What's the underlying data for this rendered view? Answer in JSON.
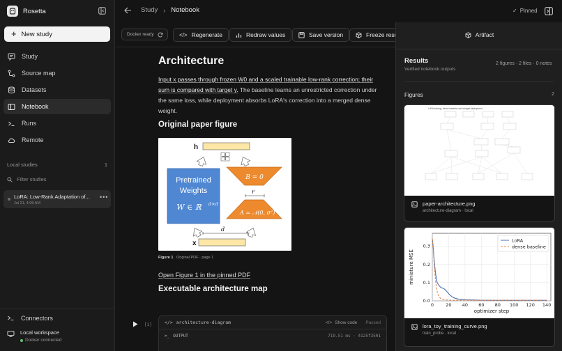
{
  "app": {
    "name": "Rosetta"
  },
  "sidebar": {
    "new_study": "New study",
    "nav": [
      {
        "label": "Study",
        "icon": "chat-icon"
      },
      {
        "label": "Source map",
        "icon": "branch-icon"
      },
      {
        "label": "Datasets",
        "icon": "database-icon"
      },
      {
        "label": "Notebook",
        "icon": "notebook-icon",
        "active": true
      },
      {
        "label": "Runs",
        "icon": "terminal-icon"
      },
      {
        "label": "Remote",
        "icon": "cloud-icon"
      }
    ],
    "local_studies_label": "Local studies",
    "local_studies_count": "1",
    "filter_placeholder": "Filter studies",
    "study": {
      "title": "LoRA: Low-Rank Adaptation of...",
      "date": "Jul 21, 4:09 AM"
    },
    "connectors": "Connectors",
    "workspace": {
      "title": "Local workspace",
      "status": "Docker connected"
    }
  },
  "breadcrumb": {
    "parent": "Study",
    "current": "Notebook"
  },
  "pinned": "Pinned",
  "toolbar": {
    "docker_status": "Docker ready",
    "regenerate": "Regenerate",
    "redraw": "Redraw values",
    "save": "Save version",
    "freeze": "Freeze results"
  },
  "notebook": {
    "title": "Architecture",
    "intro_highlight": "Input x passes through frozen W0 and a scaled trainable low-rank correction; their sum is compared with target y.",
    "intro_rest": " The baseline learns an unrestricted correction under the same loss, while deployment absorbs LoRA's correction into a merged dense weight.",
    "paper_heading": "Original paper figure",
    "figure": {
      "h": "h",
      "x": "x",
      "pretrained": "Pretrained",
      "weights": "Weights",
      "w_formula": "W ∈ ℝ",
      "w_sup": "d×d",
      "b_formula": "B = 0",
      "a_formula": "A = 𝒩(0, σ",
      "a_sup": "2",
      "a_close": ")",
      "r": "r",
      "d": "d"
    },
    "caption_label": "Figure 1",
    "caption_source": "Original PDF · page 1",
    "link": "Open Figure 1 in the pinned PDF",
    "map_heading": "Executable architecture map",
    "cell": {
      "number": "[1]",
      "name": "architecture-diagram",
      "show_code": "Show code",
      "status": "Passed",
      "output_label": "OUTPUT",
      "output_meta": "719.51 ms · 4125f3501"
    }
  },
  "panel": {
    "title": "Artifact",
    "results": "Results",
    "results_meta": "2 figures · 2 files · 0 notes",
    "results_sub": "Verified notebook outputs",
    "figures_label": "Figures",
    "figures_count": "2",
    "cards": [
      {
        "name": "paper-architecture.png",
        "meta": "architecture-diagram · local",
        "thumb_title": "LoRA training, dense baseline and merged deployment"
      },
      {
        "name": "lora_toy_training_curve.png",
        "meta": "train_probe · local"
      }
    ]
  },
  "chart_data": {
    "type": "line",
    "title": "",
    "xlabel": "optimizer step",
    "ylabel": "miniature MSE",
    "xlim": [
      0,
      145
    ],
    "ylim": [
      0,
      0.37
    ],
    "xticks": [
      0,
      20,
      40,
      60,
      80,
      100,
      120,
      140
    ],
    "yticks": [
      0.0,
      0.1,
      0.2,
      0.3
    ],
    "ytick_labels": [
      "0.0",
      "0.1",
      "0.2",
      "0.3"
    ],
    "grid": true,
    "legend": "top-right",
    "series": [
      {
        "name": "LoRA",
        "color": "#4c72b0",
        "style": "solid",
        "x": [
          0,
          1,
          2,
          3,
          4,
          5,
          6,
          8,
          10,
          12,
          14,
          16,
          18,
          20,
          22,
          25,
          28,
          32,
          36,
          40,
          50,
          60,
          80,
          100,
          120,
          140
        ],
        "y": [
          0.34,
          0.3,
          0.24,
          0.19,
          0.15,
          0.12,
          0.1,
          0.085,
          0.075,
          0.07,
          0.068,
          0.06,
          0.05,
          0.04,
          0.03,
          0.02,
          0.014,
          0.01,
          0.008,
          0.006,
          0.005,
          0.004,
          0.003,
          0.003,
          0.003,
          0.003
        ]
      },
      {
        "name": "dense baseline",
        "color": "#dd8452",
        "style": "dashed",
        "x": [
          0,
          1,
          2,
          3,
          4,
          5,
          6,
          7,
          8,
          10,
          12,
          15,
          20,
          30,
          40,
          60,
          80,
          100,
          120,
          140
        ],
        "y": [
          0.34,
          0.29,
          0.22,
          0.16,
          0.11,
          0.075,
          0.05,
          0.035,
          0.025,
          0.014,
          0.009,
          0.006,
          0.004,
          0.003,
          0.003,
          0.003,
          0.003,
          0.003,
          0.003,
          0.003
        ]
      }
    ]
  }
}
